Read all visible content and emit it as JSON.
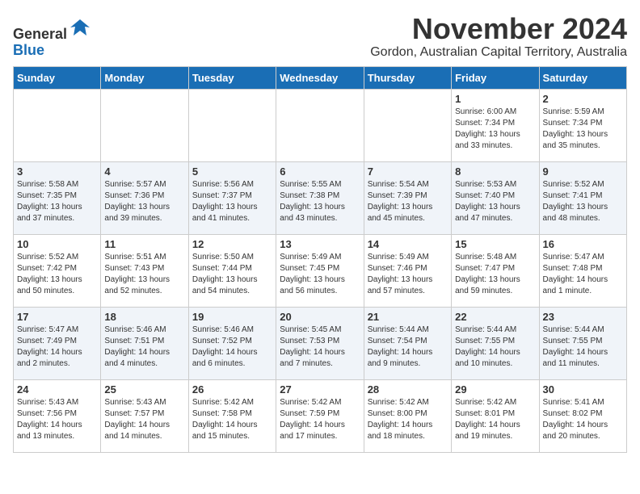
{
  "header": {
    "logo": {
      "line1": "General",
      "line2": "Blue"
    },
    "title": "November 2024",
    "subtitle": "Gordon, Australian Capital Territory, Australia"
  },
  "days_of_week": [
    "Sunday",
    "Monday",
    "Tuesday",
    "Wednesday",
    "Thursday",
    "Friday",
    "Saturday"
  ],
  "weeks": [
    [
      {
        "day": "",
        "info": ""
      },
      {
        "day": "",
        "info": ""
      },
      {
        "day": "",
        "info": ""
      },
      {
        "day": "",
        "info": ""
      },
      {
        "day": "",
        "info": ""
      },
      {
        "day": "1",
        "info": "Sunrise: 6:00 AM\nSunset: 7:34 PM\nDaylight: 13 hours\nand 33 minutes."
      },
      {
        "day": "2",
        "info": "Sunrise: 5:59 AM\nSunset: 7:34 PM\nDaylight: 13 hours\nand 35 minutes."
      }
    ],
    [
      {
        "day": "3",
        "info": "Sunrise: 5:58 AM\nSunset: 7:35 PM\nDaylight: 13 hours\nand 37 minutes."
      },
      {
        "day": "4",
        "info": "Sunrise: 5:57 AM\nSunset: 7:36 PM\nDaylight: 13 hours\nand 39 minutes."
      },
      {
        "day": "5",
        "info": "Sunrise: 5:56 AM\nSunset: 7:37 PM\nDaylight: 13 hours\nand 41 minutes."
      },
      {
        "day": "6",
        "info": "Sunrise: 5:55 AM\nSunset: 7:38 PM\nDaylight: 13 hours\nand 43 minutes."
      },
      {
        "day": "7",
        "info": "Sunrise: 5:54 AM\nSunset: 7:39 PM\nDaylight: 13 hours\nand 45 minutes."
      },
      {
        "day": "8",
        "info": "Sunrise: 5:53 AM\nSunset: 7:40 PM\nDaylight: 13 hours\nand 47 minutes."
      },
      {
        "day": "9",
        "info": "Sunrise: 5:52 AM\nSunset: 7:41 PM\nDaylight: 13 hours\nand 48 minutes."
      }
    ],
    [
      {
        "day": "10",
        "info": "Sunrise: 5:52 AM\nSunset: 7:42 PM\nDaylight: 13 hours\nand 50 minutes."
      },
      {
        "day": "11",
        "info": "Sunrise: 5:51 AM\nSunset: 7:43 PM\nDaylight: 13 hours\nand 52 minutes."
      },
      {
        "day": "12",
        "info": "Sunrise: 5:50 AM\nSunset: 7:44 PM\nDaylight: 13 hours\nand 54 minutes."
      },
      {
        "day": "13",
        "info": "Sunrise: 5:49 AM\nSunset: 7:45 PM\nDaylight: 13 hours\nand 56 minutes."
      },
      {
        "day": "14",
        "info": "Sunrise: 5:49 AM\nSunset: 7:46 PM\nDaylight: 13 hours\nand 57 minutes."
      },
      {
        "day": "15",
        "info": "Sunrise: 5:48 AM\nSunset: 7:47 PM\nDaylight: 13 hours\nand 59 minutes."
      },
      {
        "day": "16",
        "info": "Sunrise: 5:47 AM\nSunset: 7:48 PM\nDaylight: 14 hours\nand 1 minute."
      }
    ],
    [
      {
        "day": "17",
        "info": "Sunrise: 5:47 AM\nSunset: 7:49 PM\nDaylight: 14 hours\nand 2 minutes."
      },
      {
        "day": "18",
        "info": "Sunrise: 5:46 AM\nSunset: 7:51 PM\nDaylight: 14 hours\nand 4 minutes."
      },
      {
        "day": "19",
        "info": "Sunrise: 5:46 AM\nSunset: 7:52 PM\nDaylight: 14 hours\nand 6 minutes."
      },
      {
        "day": "20",
        "info": "Sunrise: 5:45 AM\nSunset: 7:53 PM\nDaylight: 14 hours\nand 7 minutes."
      },
      {
        "day": "21",
        "info": "Sunrise: 5:44 AM\nSunset: 7:54 PM\nDaylight: 14 hours\nand 9 minutes."
      },
      {
        "day": "22",
        "info": "Sunrise: 5:44 AM\nSunset: 7:55 PM\nDaylight: 14 hours\nand 10 minutes."
      },
      {
        "day": "23",
        "info": "Sunrise: 5:44 AM\nSunset: 7:55 PM\nDaylight: 14 hours\nand 11 minutes."
      }
    ],
    [
      {
        "day": "24",
        "info": "Sunrise: 5:43 AM\nSunset: 7:56 PM\nDaylight: 14 hours\nand 13 minutes."
      },
      {
        "day": "25",
        "info": "Sunrise: 5:43 AM\nSunset: 7:57 PM\nDaylight: 14 hours\nand 14 minutes."
      },
      {
        "day": "26",
        "info": "Sunrise: 5:42 AM\nSunset: 7:58 PM\nDaylight: 14 hours\nand 15 minutes."
      },
      {
        "day": "27",
        "info": "Sunrise: 5:42 AM\nSunset: 7:59 PM\nDaylight: 14 hours\nand 17 minutes."
      },
      {
        "day": "28",
        "info": "Sunrise: 5:42 AM\nSunset: 8:00 PM\nDaylight: 14 hours\nand 18 minutes."
      },
      {
        "day": "29",
        "info": "Sunrise: 5:42 AM\nSunset: 8:01 PM\nDaylight: 14 hours\nand 19 minutes."
      },
      {
        "day": "30",
        "info": "Sunrise: 5:41 AM\nSunset: 8:02 PM\nDaylight: 14 hours\nand 20 minutes."
      }
    ]
  ]
}
